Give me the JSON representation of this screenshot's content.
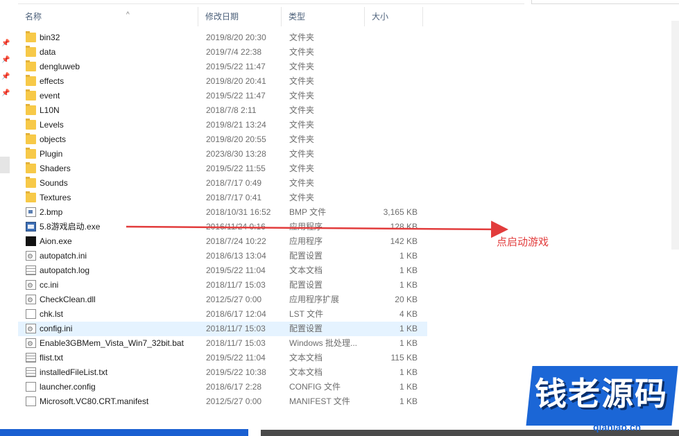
{
  "header": {
    "name": "名称",
    "date": "修改日期",
    "type": "类型",
    "size": "大小"
  },
  "files": [
    {
      "name": "bin32",
      "date": "2019/8/20 20:30",
      "type": "文件夹",
      "size": "",
      "icon": "folder-icon"
    },
    {
      "name": "data",
      "date": "2019/7/4 22:38",
      "type": "文件夹",
      "size": "",
      "icon": "folder-icon"
    },
    {
      "name": "dengluweb",
      "date": "2019/5/22 11:47",
      "type": "文件夹",
      "size": "",
      "icon": "folder-icon"
    },
    {
      "name": "effects",
      "date": "2019/8/20 20:41",
      "type": "文件夹",
      "size": "",
      "icon": "folder-icon"
    },
    {
      "name": "event",
      "date": "2019/5/22 11:47",
      "type": "文件夹",
      "size": "",
      "icon": "folder-icon"
    },
    {
      "name": "L10N",
      "date": "2018/7/8 2:11",
      "type": "文件夹",
      "size": "",
      "icon": "folder-icon"
    },
    {
      "name": "Levels",
      "date": "2019/8/21 13:24",
      "type": "文件夹",
      "size": "",
      "icon": "folder-icon"
    },
    {
      "name": "objects",
      "date": "2019/8/20 20:55",
      "type": "文件夹",
      "size": "",
      "icon": "folder-icon"
    },
    {
      "name": "Plugin",
      "date": "2023/8/30 13:28",
      "type": "文件夹",
      "size": "",
      "icon": "folder-icon"
    },
    {
      "name": "Shaders",
      "date": "2019/5/22 11:55",
      "type": "文件夹",
      "size": "",
      "icon": "folder-icon"
    },
    {
      "name": "Sounds",
      "date": "2018/7/17 0:49",
      "type": "文件夹",
      "size": "",
      "icon": "folder-icon"
    },
    {
      "name": "Textures",
      "date": "2018/7/17 0:41",
      "type": "文件夹",
      "size": "",
      "icon": "folder-icon"
    },
    {
      "name": "2.bmp",
      "date": "2018/10/31 16:52",
      "type": "BMP 文件",
      "size": "3,165 KB",
      "icon": "image-file-icon"
    },
    {
      "name": "5.8游戏启动.exe",
      "date": "2016/11/24 0:16",
      "type": "应用程序",
      "size": "128 KB",
      "icon": "exe-icon"
    },
    {
      "name": "Aion.exe",
      "date": "2018/7/24 10:22",
      "type": "应用程序",
      "size": "142 KB",
      "icon": "aion-app-icon"
    },
    {
      "name": "autopatch.ini",
      "date": "2018/6/13 13:04",
      "type": "配置设置",
      "size": "1 KB",
      "icon": "config-file-icon"
    },
    {
      "name": "autopatch.log",
      "date": "2019/5/22 11:04",
      "type": "文本文档",
      "size": "1 KB",
      "icon": "text-file-icon"
    },
    {
      "name": "cc.ini",
      "date": "2018/11/7 15:03",
      "type": "配置设置",
      "size": "1 KB",
      "icon": "config-file-icon"
    },
    {
      "name": "CheckClean.dll",
      "date": "2012/5/27 0:00",
      "type": "应用程序扩展",
      "size": "20 KB",
      "icon": "dll-file-icon"
    },
    {
      "name": "chk.lst",
      "date": "2018/6/17 12:04",
      "type": "LST 文件",
      "size": "4 KB",
      "icon": "generic-file-icon"
    },
    {
      "name": "config.ini",
      "date": "2018/11/7 15:03",
      "type": "配置设置",
      "size": "1 KB",
      "icon": "config-file-icon"
    },
    {
      "name": "Enable3GBMem_Vista_Win7_32bit.bat",
      "date": "2018/11/7 15:03",
      "type": "Windows 批处理...",
      "size": "1 KB",
      "icon": "batch-file-icon"
    },
    {
      "name": "flist.txt",
      "date": "2019/5/22 11:04",
      "type": "文本文档",
      "size": "115 KB",
      "icon": "text-file-icon"
    },
    {
      "name": "installedFileList.txt",
      "date": "2019/5/22 10:38",
      "type": "文本文档",
      "size": "1 KB",
      "icon": "text-file-icon"
    },
    {
      "name": "launcher.config",
      "date": "2018/6/17 2:28",
      "type": "CONFIG 文件",
      "size": "1 KB",
      "icon": "generic-file-icon"
    },
    {
      "name": "Microsoft.VC80.CRT.manifest",
      "date": "2012/5/27 0:00",
      "type": "MANIFEST 文件",
      "size": "1 KB",
      "icon": "generic-file-icon"
    }
  ],
  "annotation": "点启动游戏",
  "watermark": {
    "title": "钱老源码",
    "site": "qianlao.cn"
  },
  "colors": {
    "annotation": "#e23c3c",
    "watermark_blue": "#1b66d6",
    "selected_row": "#e5f3ff"
  }
}
